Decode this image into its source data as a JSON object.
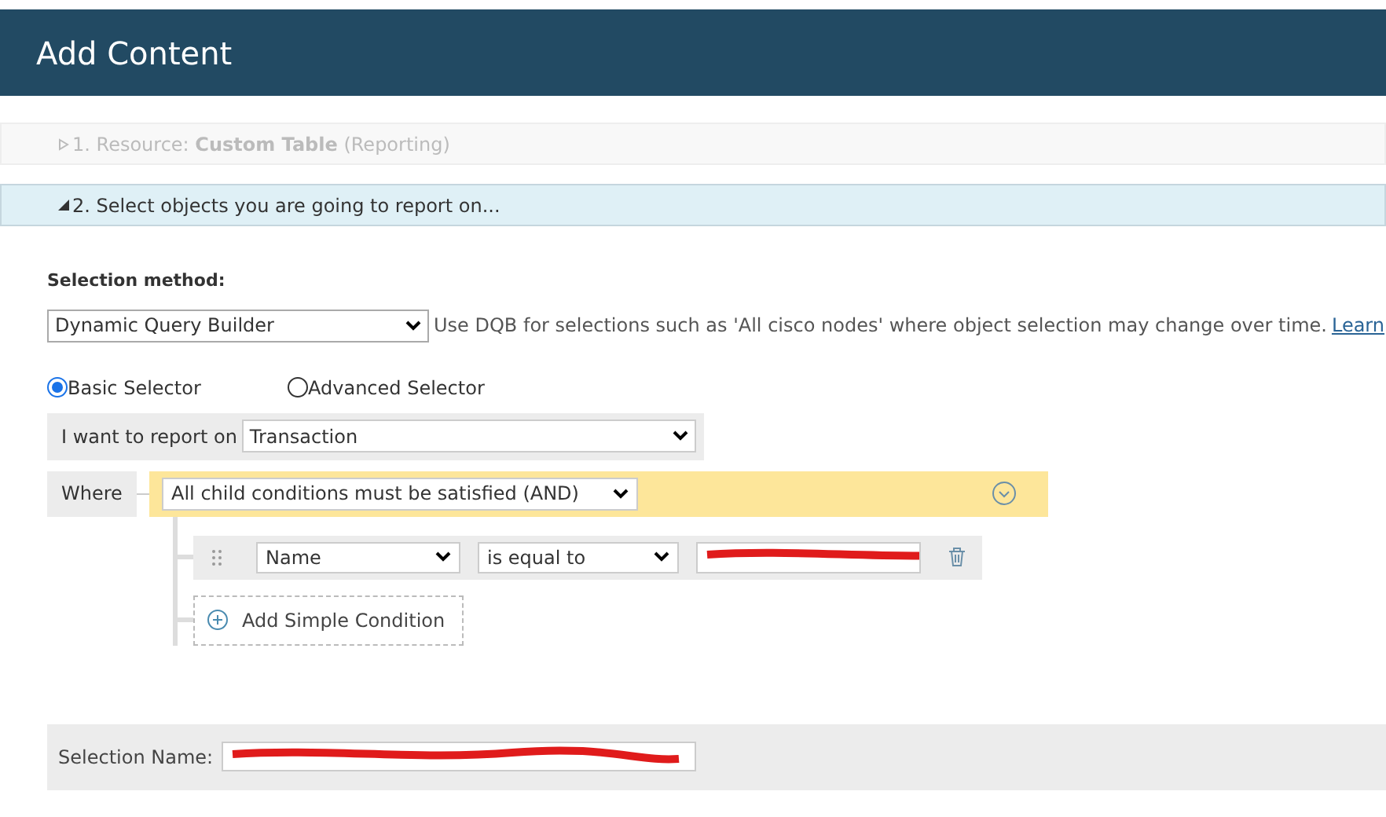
{
  "header": {
    "title": "Add Content"
  },
  "steps": [
    {
      "text": "1. Resource: **Custom Table** (Reporting)",
      "expanded": false
    },
    {
      "text": "2. Select objects you are going to report on...",
      "expanded": true
    }
  ],
  "selection_method": {
    "label": "Selection method:",
    "value": "Dynamic Query Builder",
    "description": "Use DQB for selections such as 'All cisco nodes' where object selection may change over time.",
    "link": "Learn"
  },
  "selectors": [
    {
      "label": "Basic Selector",
      "selected": true
    },
    {
      "label": "Advanced Selector",
      "selected": false
    }
  ],
  "report_on": {
    "label": "I want to report on",
    "value": "Transaction"
  },
  "where": {
    "label": "Where",
    "group_value": "All child conditions must be satisfied (AND)",
    "conditions": [
      {
        "field": "Name",
        "operator": "is equal to",
        "redacted": true
      }
    ],
    "add_button": "Add Simple Condition"
  },
  "selection_name": {
    "label": "Selection Name:",
    "redacted": true
  }
}
